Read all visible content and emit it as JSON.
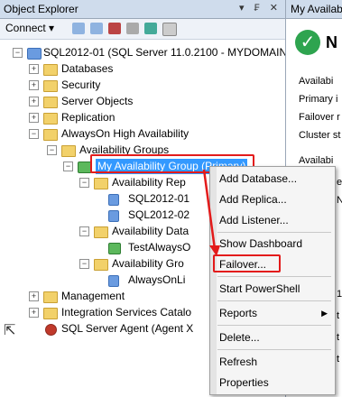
{
  "object_explorer": {
    "title": "Object Explorer",
    "title_controls": "▾ ₣ ✕",
    "connect_label": "Connect ▾",
    "tree": [
      {
        "label": "SQL2012-01 (SQL Server 11.0.2100 - MYDOMAIN\\",
        "exp": "−"
      },
      {
        "label": "Databases",
        "exp": "+"
      },
      {
        "label": "Security",
        "exp": "+"
      },
      {
        "label": "Server Objects",
        "exp": "+"
      },
      {
        "label": "Replication",
        "exp": "+"
      },
      {
        "label": "AlwaysOn High Availability",
        "exp": "−"
      },
      {
        "label": "Availability Groups",
        "exp": "−"
      },
      {
        "label": "My Availability Group (Primary)",
        "exp": "−"
      },
      {
        "label": "Availability Rep",
        "exp": "−"
      },
      {
        "label": "SQL2012-01",
        "exp": ""
      },
      {
        "label": "SQL2012-02",
        "exp": ""
      },
      {
        "label": "Availability Data",
        "exp": "−"
      },
      {
        "label": "TestAlwaysO",
        "exp": ""
      },
      {
        "label": "Availability Gro",
        "exp": "−"
      },
      {
        "label": "AlwaysOnLi",
        "exp": ""
      },
      {
        "label": "Management",
        "exp": "+"
      },
      {
        "label": "Integration Services Catalo",
        "exp": "+"
      },
      {
        "label": "SQL Server Agent (Agent X",
        "exp": ""
      }
    ]
  },
  "right_pane": {
    "title": "My Availabi",
    "big_text": "N",
    "lines": [
      "Availabi",
      "Primary i",
      "Failover r",
      "Cluster st",
      "Availabi",
      "e",
      "N",
      "1",
      "1",
      "1",
      "t",
      "t",
      "t"
    ]
  },
  "context_menu": {
    "items": [
      "Add Database...",
      "Add Replica...",
      "Add Listener...",
      "Show Dashboard",
      "Failover...",
      "Start PowerShell",
      "Reports",
      "Delete...",
      "Refresh",
      "Properties"
    ],
    "submenu_arrow": "▶"
  },
  "colors": {
    "highlight_red": "#e31b1b",
    "selection_blue": "#3399ff",
    "title_bar": "#cfdcec"
  }
}
